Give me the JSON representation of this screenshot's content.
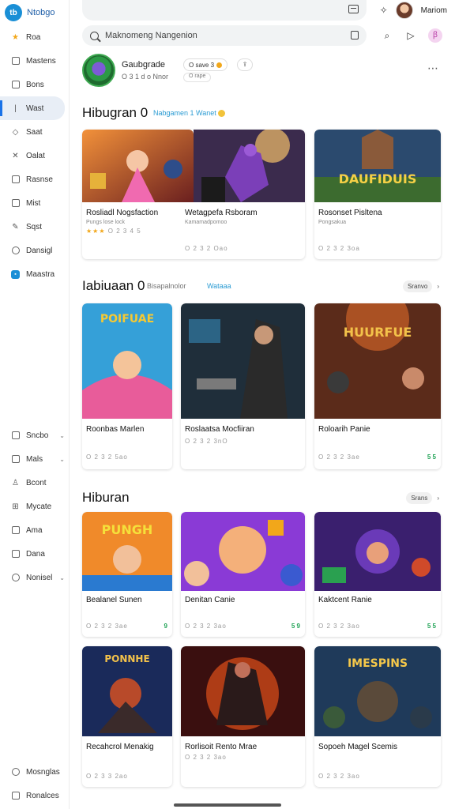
{
  "app": {
    "name": "Ntobgo",
    "logo_text": "tb"
  },
  "sidebar": {
    "items": [
      {
        "label": "Roa",
        "icon": "star-icon"
      },
      {
        "label": "Mastens",
        "icon": "box-icon"
      },
      {
        "label": "Bons",
        "icon": "box-icon"
      },
      {
        "label": "Wast",
        "icon": "line-icon"
      },
      {
        "label": "Saat",
        "icon": "tag-icon"
      },
      {
        "label": "Oalat",
        "icon": "cross-icon"
      },
      {
        "label": "Rasnse",
        "icon": "box-icon"
      },
      {
        "label": "Mist",
        "icon": "box-icon"
      },
      {
        "label": "Sqst",
        "icon": "edit-icon"
      },
      {
        "label": "Dansigl",
        "icon": "circle-icon"
      },
      {
        "label": "Maastra",
        "icon": "app-icon"
      }
    ],
    "lower_items": [
      {
        "label": "Sncbo",
        "icon": "box-icon"
      },
      {
        "label": "Mals",
        "icon": "box-icon"
      },
      {
        "label": "Bcont",
        "icon": "person-icon"
      },
      {
        "label": "Mycate",
        "icon": "grid-icon"
      },
      {
        "label": "Ama",
        "icon": "box-icon"
      },
      {
        "label": "Dana",
        "icon": "box-icon"
      },
      {
        "label": "Nonisel",
        "icon": "circle-icon"
      }
    ],
    "footer_items": [
      {
        "label": "Mosnglas",
        "icon": "circle-icon"
      },
      {
        "label": "Ronalces",
        "icon": "box-icon"
      }
    ]
  },
  "topbar": {
    "user_name": "Mariom"
  },
  "search": {
    "value": "Maknomeng Nangenion"
  },
  "profile": {
    "name": "Gaubgrade",
    "subtitle": "O 3 1 d o Nnor",
    "chip_label": "O save 3",
    "chip_sub": "O rape"
  },
  "sections": [
    {
      "title": "Hibugran 0",
      "link": "Nabgamen 1 Wanet",
      "cards": [
        {
          "title": "Rosliadl Nogsfaction",
          "sub": "Pungs lose lock",
          "rating": "O 2 3 4 5",
          "badge": "",
          "art": "fantasy-queen"
        },
        {
          "title": "Wetagpefa Rsboram",
          "sub": "Kamamadpomoo",
          "rating": "O 2 3 2 Oao",
          "badge": "O",
          "art": "purple-ninja"
        },
        {
          "title": "Rosonset Pisltena",
          "sub": "Pongsakua",
          "rating": "O 2 3 2 3oa",
          "badge": "",
          "art": "castle-battle",
          "art_label": "DAUFIDUIS"
        }
      ]
    },
    {
      "title": "Iabiuaan 0",
      "link": "Wataaa",
      "link_prefix": "Bisapalnolor",
      "more": "Sranvo",
      "cards": [
        {
          "title": "Roonbas Marlen",
          "sub": "",
          "rating": "O 2 3 2 5ao",
          "badge": "",
          "art": "cartoon-adventure",
          "art_label": "POIFUAE"
        },
        {
          "title": "Roslaatsa Mocfiiran",
          "sub": "",
          "rating": "O 2 3 2 3nO",
          "badge": "",
          "art": "detective"
        },
        {
          "title": "Roloarih Panie",
          "sub": "",
          "rating": "O 2 3 2 3ae",
          "badge": "5 5",
          "art": "heist",
          "art_label": "HUURFUE"
        }
      ]
    },
    {
      "title": "Hiburan",
      "more": "Srans",
      "cards": [
        {
          "title": "Bealanel Sunen",
          "sub": "",
          "rating": "O 2 3 2 3ae",
          "badge": "9",
          "art": "punch-heroes",
          "art_label": "PUNGH"
        },
        {
          "title": "Denitan Canie",
          "sub": "",
          "rating": "O 2 3 2 3ao",
          "badge": "5 9",
          "art": "happy-kids"
        },
        {
          "title": "Kaktcent Ranie",
          "sub": "",
          "rating": "O 2 3 2 3ao",
          "badge": "5 5",
          "art": "hooded-hero"
        },
        {
          "title": "Recahcrol Menakig",
          "sub": "",
          "rating": "O 2 3 3 2ao",
          "badge": "",
          "art": "space-warrior",
          "art_label": "PONNHE"
        },
        {
          "title": "Rorlisoit Rento Mrae",
          "sub": "",
          "rating": "O 2 3 2 3ao",
          "badge": "",
          "art": "fire-fighter"
        },
        {
          "title": "Sopoeh Magel Scemis",
          "sub": "",
          "rating": "O 2 3 2 3ao",
          "badge": "",
          "art": "armor-knight",
          "art_label": "IMESPINS"
        }
      ]
    }
  ],
  "colors": {
    "accent": "#1a73e8",
    "link": "#2a9bd3",
    "star": "#f2a71a",
    "badge": "#21a356"
  }
}
